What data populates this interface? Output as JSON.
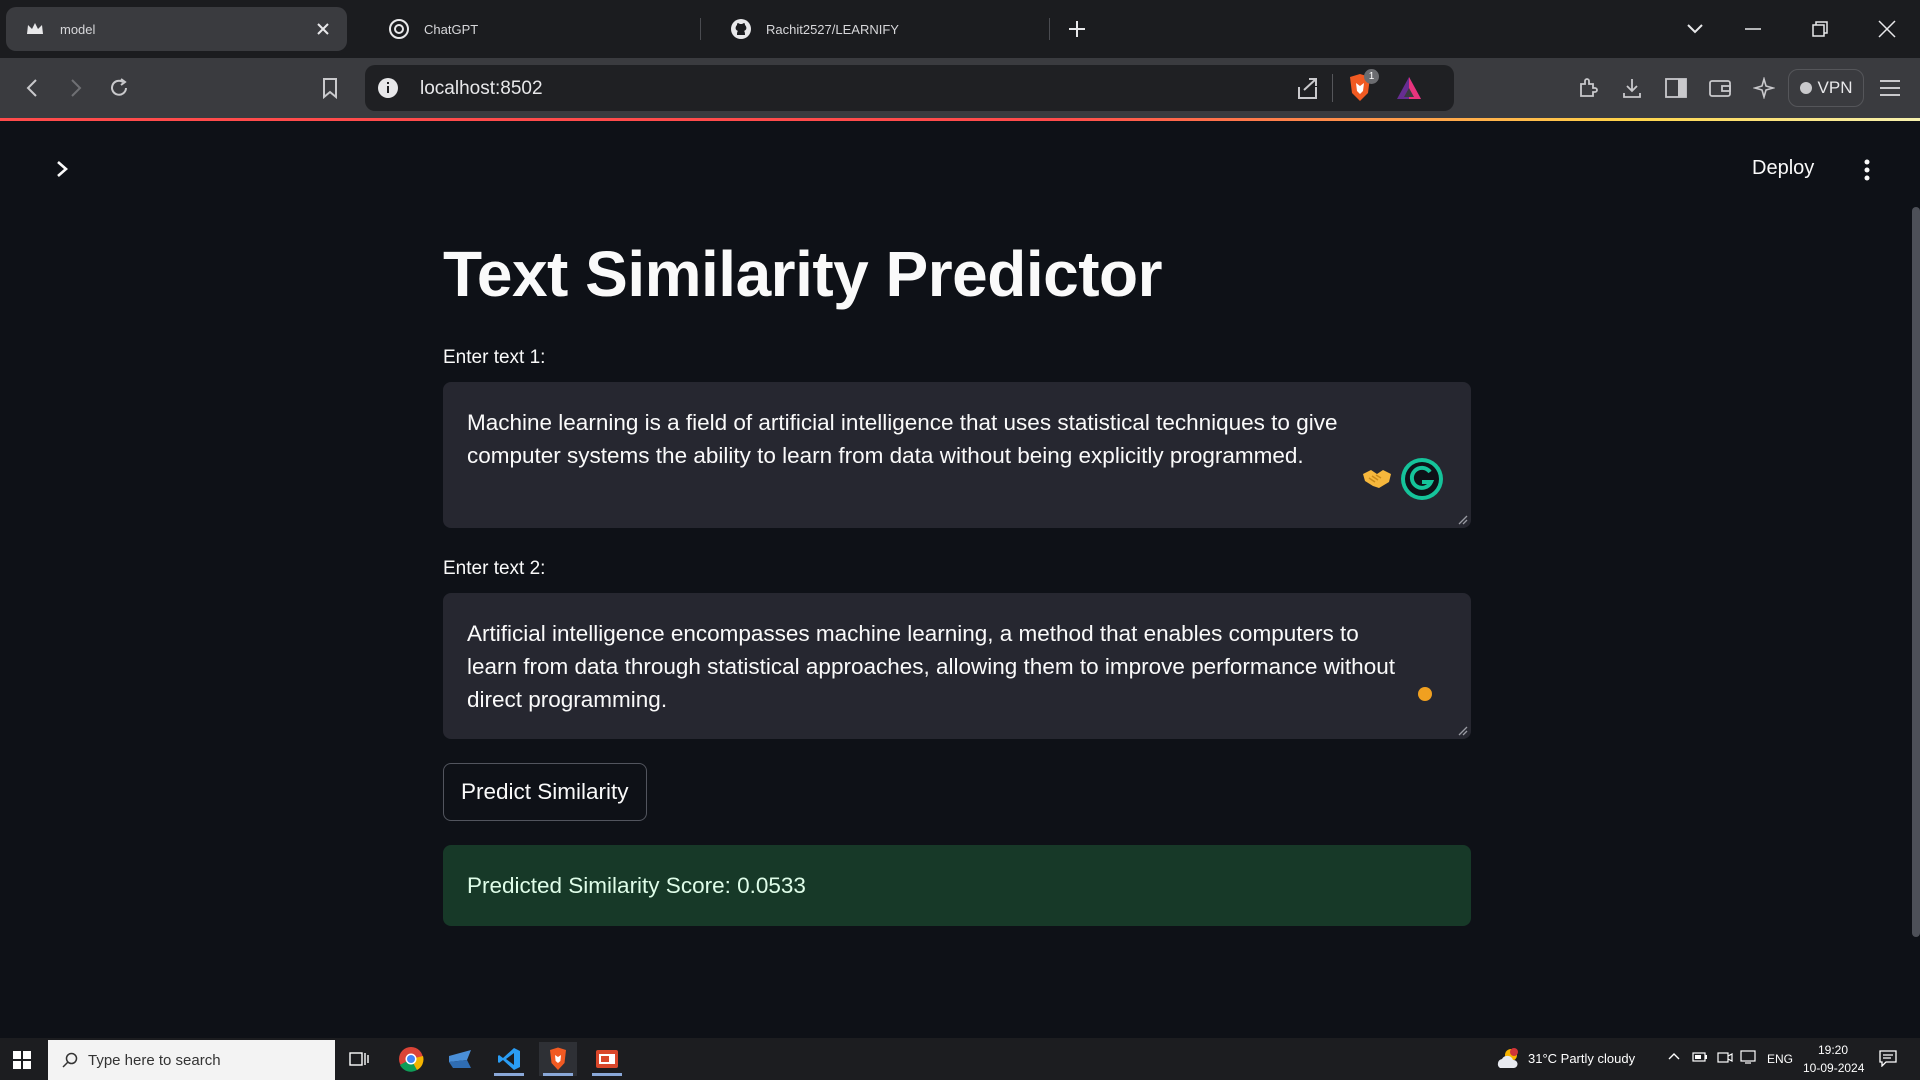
{
  "browser": {
    "tabs": [
      {
        "title": "model",
        "active": true,
        "icon": "streamlit-crown-icon"
      },
      {
        "title": "ChatGPT",
        "active": false,
        "icon": "chatgpt-icon"
      },
      {
        "title": "Rachit2527/LEARNIFY",
        "active": false,
        "icon": "github-icon"
      }
    ],
    "url": "localhost:8502",
    "vpn_label": "VPN",
    "shields_badge": "1",
    "accent_color": "#ff4b4b"
  },
  "app": {
    "deploy_label": "Deploy",
    "title": "Text Similarity Predictor",
    "input1": {
      "label": "Enter text 1:",
      "value": "Machine learning is a field of artificial intelligence that uses statistical techniques to give computer systems the ability to learn from data without being explicitly programmed."
    },
    "input2": {
      "label": "Enter text 2:",
      "value": "Artificial intelligence encompasses machine learning, a method that enables computers to learn from data through statistical approaches, allowing them to improve performance without direct programming."
    },
    "predict_button": "Predict Similarity",
    "result_text": "Predicted Similarity Score: 0.0533",
    "success_bg": "#173928",
    "success_text_color": "#dffde9"
  },
  "taskbar": {
    "search_placeholder": "Type here to search",
    "weather": "31°C  Partly cloudy",
    "language": "ENG",
    "time": "19:20",
    "date": "10-09-2024"
  }
}
